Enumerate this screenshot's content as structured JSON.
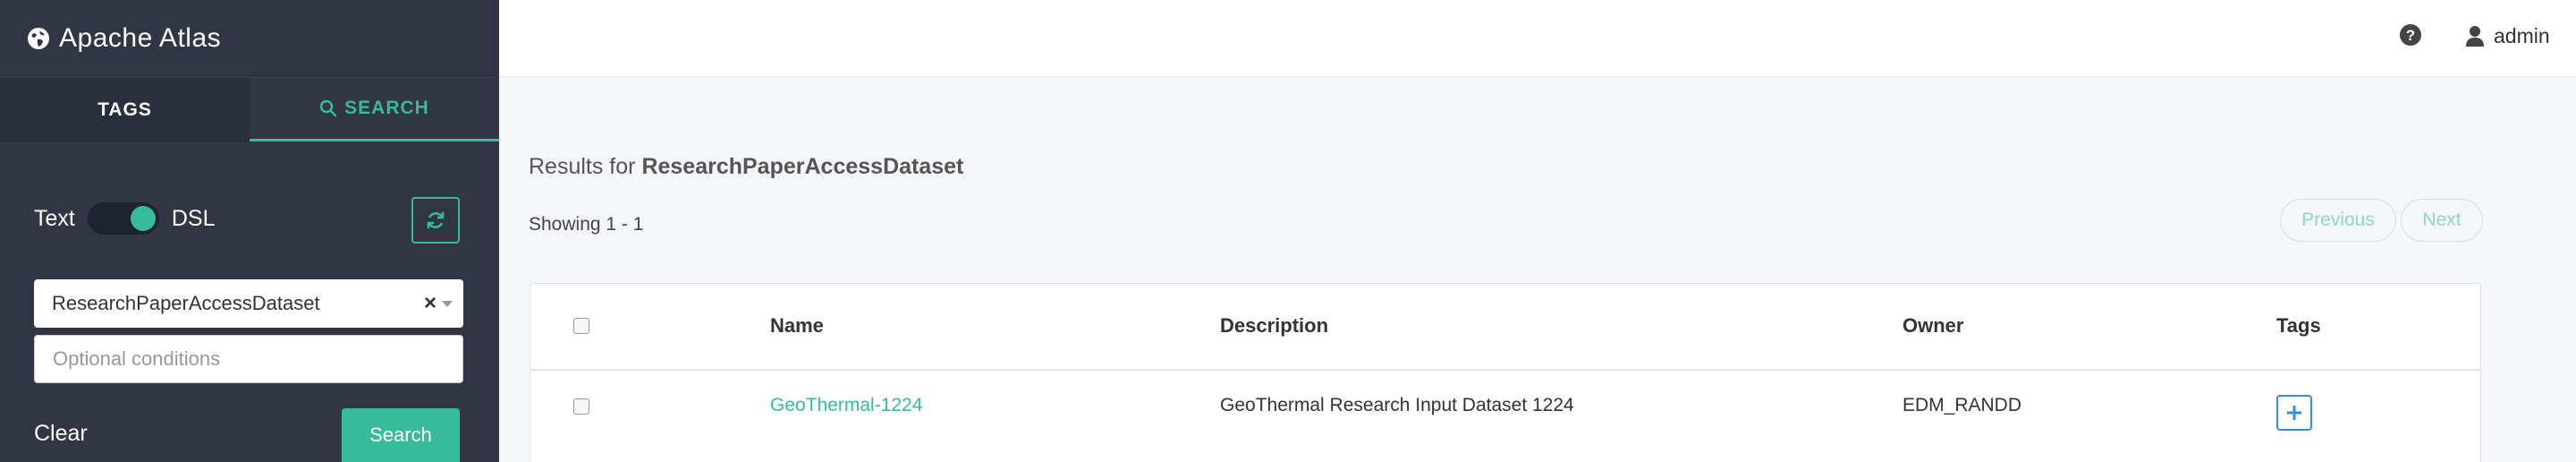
{
  "app": {
    "title": "Apache Atlas"
  },
  "sidebar": {
    "tabs": [
      {
        "label": "TAGS"
      },
      {
        "label": "SEARCH"
      }
    ],
    "toggle": {
      "left_label": "Text",
      "right_label": "DSL",
      "state": "DSL"
    },
    "type_select": {
      "value": "ResearchPaperAccessDataset",
      "clear": "×"
    },
    "conditions": {
      "placeholder": "Optional conditions",
      "value": ""
    },
    "clear_label": "Clear",
    "search_label": "Search"
  },
  "header": {
    "user": "admin"
  },
  "results": {
    "prefix": "Results for ",
    "query": "ResearchPaperAccessDataset",
    "showing": "Showing 1 - 1",
    "previous_label": "Previous",
    "next_label": "Next",
    "columns": [
      "Name",
      "Description",
      "Owner",
      "Tags"
    ],
    "rows": [
      {
        "name": "GeoThermal-1224",
        "description": "GeoThermal Research Input Dataset 1224",
        "owner": "EDM_RANDD"
      }
    ]
  },
  "colors": {
    "sidebar": "#323544",
    "accent": "#37bb9b",
    "tag_button": "#3a8dd8"
  }
}
